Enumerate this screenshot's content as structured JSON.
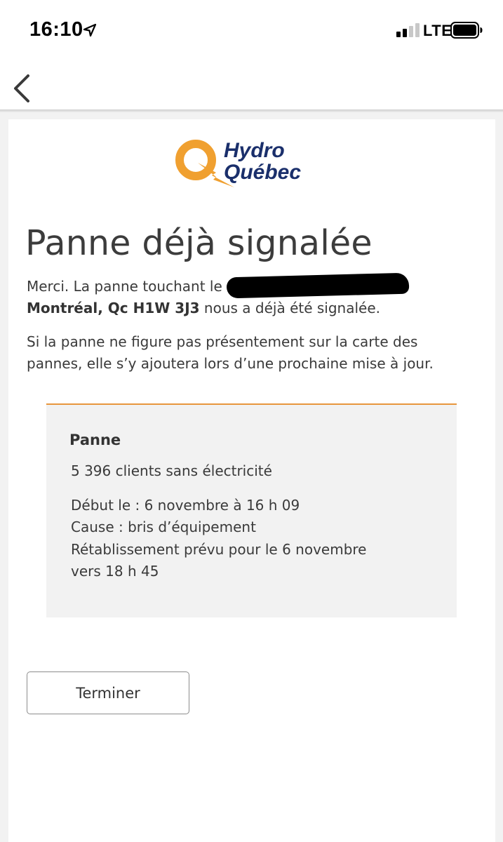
{
  "status_bar": {
    "time": "16:10",
    "network": "LTE",
    "location_icon": "location-arrow-icon",
    "signal_icon": "signal-strength-icon",
    "battery_icon": "battery-icon"
  },
  "nav": {
    "back_icon": "chevron-left-icon"
  },
  "logo": {
    "line1": "Hydro",
    "line2": "Québec",
    "colors": {
      "orange": "#f0a030",
      "navy": "#1a2f6b"
    }
  },
  "page": {
    "title": "Panne déjà signalée",
    "intro_before": "Merci. La panne touchant le ",
    "address_line": "Montréal, Qc H1W 3J3",
    "intro_after": " nous a déjà été signalée.",
    "note": "Si la panne ne figure pas présentement sur la carte des pannes, elle s’y ajoutera lors d’une prochaine mise à jour."
  },
  "outage": {
    "title": "Panne",
    "clients": "5 396 clients sans électricité",
    "start": "Début le : 6 novembre à 16 h 09",
    "cause": "Cause : bris d’équipement",
    "restore_line1": "Rétablissement prévu pour le 6 novembre",
    "restore_line2": "vers 18 h 45",
    "accent_color": "#e8963d"
  },
  "actions": {
    "finish_label": "Terminer"
  }
}
